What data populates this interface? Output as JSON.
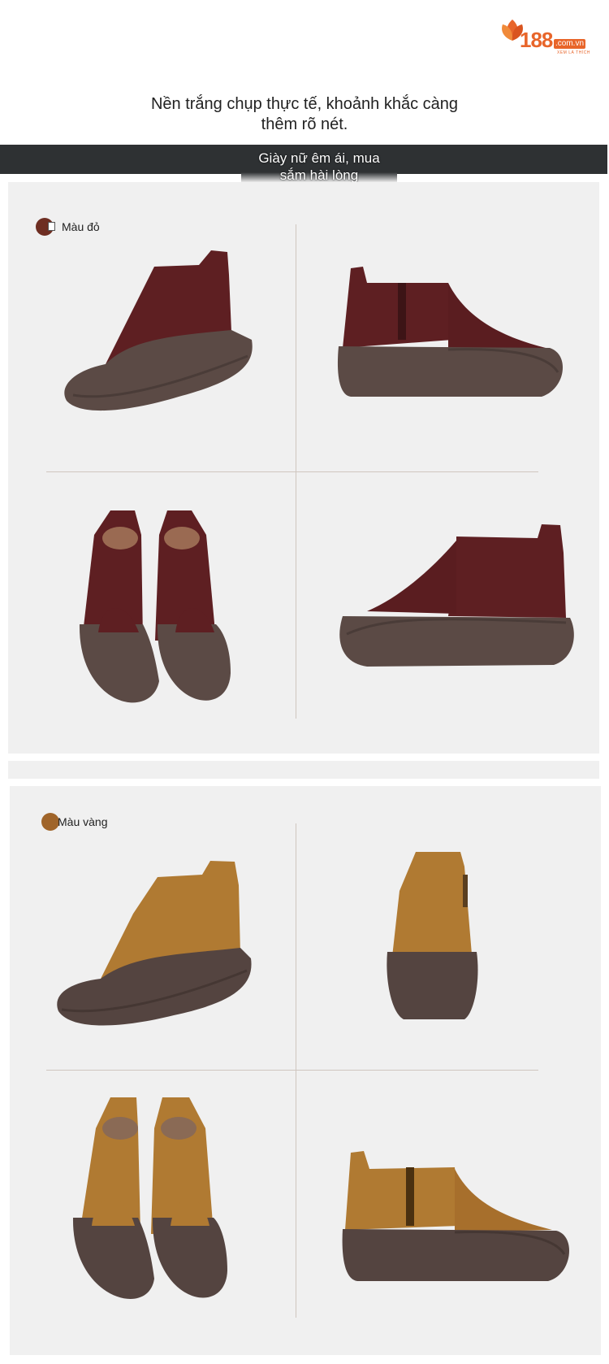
{
  "brand": {
    "name": "188",
    "domain": ".com.vn",
    "tagline": "XEM LÀ THÍCH",
    "color": "#e8652a"
  },
  "headline": {
    "line1": "Nền trắng chụp thực tế, khoảnh khắc càng",
    "line2": "thêm rõ nét."
  },
  "banner": {
    "line1": "Giày nữ êm ái, mua",
    "line2": "sắm hài lòng"
  },
  "variants": [
    {
      "label": "Màu đỏ",
      "swatch_color": "#6e2e22",
      "upper_color": "#5e1f22",
      "sole_color": "#5b4a45"
    },
    {
      "label": "Màu vàng",
      "swatch_color": "#a0652a",
      "upper_color": "#b07a32",
      "sole_color": "#544440"
    }
  ]
}
